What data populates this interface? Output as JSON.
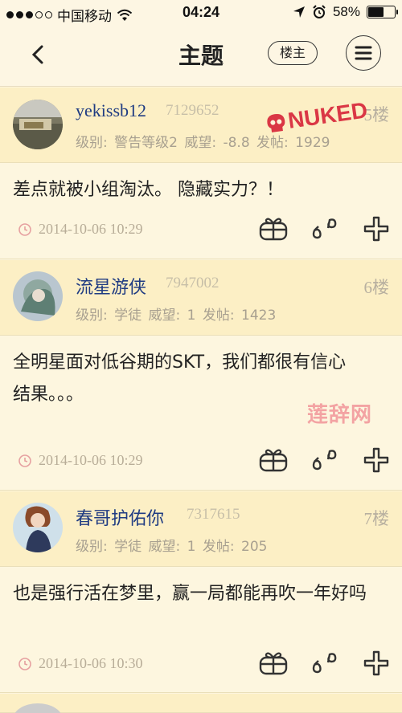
{
  "status_bar": {
    "carrier": "中国移动",
    "time": "04:24",
    "battery_percent": "58%",
    "battery_level": 0.58,
    "signal_bars": 3
  },
  "nav": {
    "title": "主题",
    "owner_only_label": "楼主"
  },
  "posts": [
    {
      "username": "yekissb12",
      "uid": "7129652",
      "floor": "5楼",
      "meta": "级别: 警告等级2  威望: -8.8  发帖: 1929",
      "content": "差点就被小组淘汰。 隐藏实力？！",
      "timestamp": "2014-10-06 10:29"
    },
    {
      "username": "流星游侠",
      "uid": "7947002",
      "floor": "6楼",
      "meta": "级别: 学徒  威望: 1  发帖: 1423",
      "content": "全明星面对低谷期的SKT，我们都很有信心\n结果。。。",
      "timestamp": "2014-10-06 10:29"
    },
    {
      "username": "春哥护佑你",
      "uid": "7317615",
      "floor": "7楼",
      "meta": "级别: 学徒  威望: 1  发帖: 205",
      "content": "也是强行活在梦里，赢一局都能再吹一年好吗",
      "timestamp": "2014-10-06 10:30"
    }
  ],
  "overlays": {
    "stamp_text": "NUKED",
    "watermark_text": "莲辞网"
  },
  "colors": {
    "username": "#1f3b82",
    "header_bg": "#fcefc5",
    "body_bg": "#fdf6df",
    "stamp": "#d8283b"
  }
}
